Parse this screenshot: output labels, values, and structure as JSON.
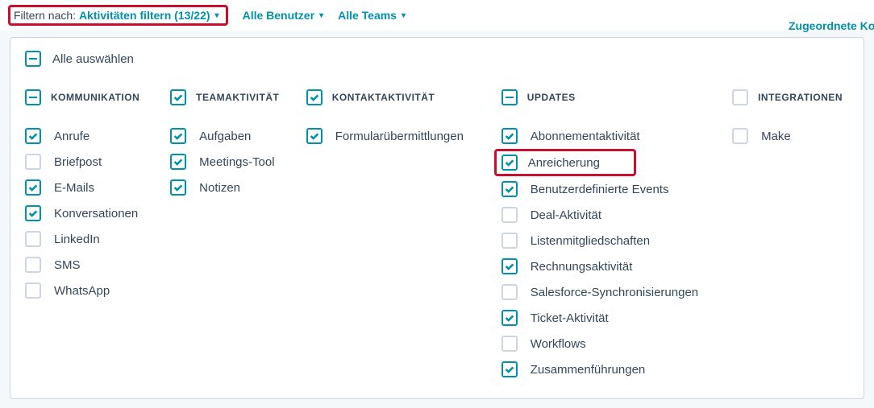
{
  "topbar": {
    "filter_label": "Filtern nach:",
    "activity_filter": "Aktivitäten filtern (13/22)",
    "all_users": "Alle Benutzer",
    "all_teams": "Alle Teams",
    "side_link_top": "Zugeordnete Ko"
  },
  "select_all": "Alle auswählen",
  "groups": {
    "kommunikation": {
      "title": "KOMMUNIKATION",
      "state": "indeterminate",
      "items": [
        {
          "label": "Anrufe",
          "checked": true
        },
        {
          "label": "Briefpost",
          "checked": false
        },
        {
          "label": "E-Mails",
          "checked": true
        },
        {
          "label": "Konversationen",
          "checked": true
        },
        {
          "label": "LinkedIn",
          "checked": false
        },
        {
          "label": "SMS",
          "checked": false
        },
        {
          "label": "WhatsApp",
          "checked": false
        }
      ]
    },
    "teamaktivitat": {
      "title": "TEAMAKTIVITÄT",
      "state": "checked",
      "items": [
        {
          "label": "Aufgaben",
          "checked": true
        },
        {
          "label": "Meetings-Tool",
          "checked": true
        },
        {
          "label": "Notizen",
          "checked": true
        }
      ]
    },
    "kontaktaktivitat": {
      "title": "KONTAKTAKTIVITÄT",
      "state": "checked",
      "items": [
        {
          "label": "Formularübermittlungen",
          "checked": true
        }
      ]
    },
    "updates": {
      "title": "UPDATES",
      "state": "indeterminate",
      "items": [
        {
          "label": "Abonnementaktivität",
          "checked": true
        },
        {
          "label": "Anreicherung",
          "checked": true,
          "highlight": true
        },
        {
          "label": "Benutzerdefinierte Events",
          "checked": true
        },
        {
          "label": "Deal-Aktivität",
          "checked": false
        },
        {
          "label": "Listenmitgliedschaften",
          "checked": false
        },
        {
          "label": "Rechnungsaktivität",
          "checked": true
        },
        {
          "label": "Salesforce-Synchronisierungen",
          "checked": false
        },
        {
          "label": "Ticket-Aktivität",
          "checked": true
        },
        {
          "label": "Workflows",
          "checked": false
        },
        {
          "label": "Zusammenführungen",
          "checked": true
        }
      ]
    },
    "integrationen": {
      "title": "INTEGRATIONEN",
      "state": "unchecked",
      "items": [
        {
          "label": "Make",
          "checked": false
        }
      ]
    }
  }
}
